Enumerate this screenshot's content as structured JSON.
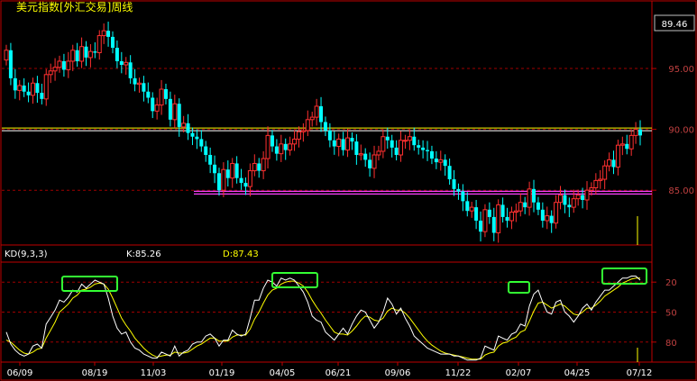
{
  "title": "美元指数[外汇交易]周线",
  "price_panel": {
    "last_value": "89.46",
    "y_ticks": [
      "95.00",
      "90.00",
      "85.00"
    ]
  },
  "kd_panel": {
    "label": "KD(9,3,3)",
    "k_text": "K:85.26",
    "d_text": "D:87.43",
    "y_ticks": [
      "80",
      "50",
      "20"
    ]
  },
  "colors": {
    "background": "#000000",
    "up_candle": "#ff3030",
    "down_candle": "#00ffff",
    "grid": "#a00000",
    "axis": "#c00000",
    "yellow_line": "#ffff00",
    "magenta_line": "#ff40ff",
    "highlight_box": "#33ff33",
    "k_line": "#ffffff",
    "d_line": "#ffff00"
  },
  "chart_data": [
    {
      "type": "candlestick",
      "ylim": [
        80.5,
        99.0
      ],
      "x_ticks": [
        "06/09",
        "08/19",
        "11/03",
        "01/19",
        "04/05",
        "06/21",
        "09/06",
        "11/22",
        "02/07",
        "04/25",
        "07/12"
      ],
      "horizontal_lines": [
        90.0,
        84.8
      ],
      "close": [
        96.5,
        94.2,
        93.2,
        93.6,
        93.1,
        92.8,
        93.8,
        93.0,
        92.5,
        94.5,
        94.8,
        95.1,
        95.6,
        94.9,
        95.6,
        96.5,
        95.6,
        96.8,
        95.9,
        96.4,
        96.3,
        97.7,
        98.1,
        97.6,
        96.7,
        95.6,
        95.3,
        95.5,
        94.2,
        93.7,
        93.8,
        93.1,
        92.6,
        91.5,
        92.0,
        93.3,
        92.5,
        90.8,
        92.1,
        90.2,
        90.5,
        89.7,
        89.4,
        89.2,
        88.6,
        87.9,
        87.1,
        86.4,
        85.0,
        86.7,
        86.0,
        87.2,
        86.0,
        85.6,
        85.3,
        86.6,
        87.2,
        86.6,
        87.6,
        89.5,
        88.6,
        88.0,
        88.8,
        88.3,
        88.8,
        89.2,
        89.8,
        89.9,
        90.8,
        91.0,
        91.9,
        90.6,
        89.9,
        89.1,
        88.6,
        89.2,
        88.3,
        89.3,
        89.0,
        87.9,
        88.0,
        87.5,
        86.8,
        87.9,
        88.2,
        89.4,
        89.1,
        88.5,
        87.9,
        89.1,
        89.1,
        89.4,
        88.7,
        88.5,
        88.3,
        88.2,
        87.6,
        87.3,
        87.5,
        87.0,
        85.9,
        85.1,
        84.9,
        84.1,
        83.3,
        83.6,
        82.5,
        81.6,
        83.4,
        82.8,
        81.5,
        83.8,
        82.8,
        82.5,
        83.2,
        83.3,
        84.0,
        83.6,
        85.1,
        84.0,
        83.4,
        82.5,
        82.9,
        82.3,
        84.0,
        84.6,
        83.8,
        83.6,
        84.3,
        84.6,
        84.2,
        85.0,
        85.2,
        85.8,
        85.9,
        87.0,
        87.5,
        86.9,
        88.7,
        88.8,
        88.4,
        89.5,
        90.0,
        89.5
      ]
    },
    {
      "type": "line",
      "ylim": [
        0,
        100
      ],
      "y_ticks": [
        20,
        50,
        80
      ],
      "series": [
        {
          "name": "K",
          "values": [
            30,
            18,
            12,
            8,
            6,
            8,
            16,
            18,
            14,
            38,
            45,
            52,
            62,
            60,
            65,
            72,
            70,
            78,
            74,
            78,
            82,
            80,
            78,
            64,
            46,
            34,
            28,
            30,
            20,
            14,
            12,
            8,
            6,
            4,
            4,
            10,
            8,
            6,
            16,
            6,
            10,
            12,
            18,
            20,
            20,
            26,
            28,
            24,
            16,
            22,
            22,
            32,
            28,
            26,
            28,
            44,
            62,
            62,
            74,
            82,
            80,
            76,
            84,
            82,
            84,
            82,
            76,
            70,
            60,
            46,
            42,
            40,
            30,
            26,
            22,
            28,
            34,
            28,
            38,
            46,
            52,
            50,
            42,
            34,
            40,
            50,
            64,
            58,
            48,
            54,
            44,
            36,
            26,
            22,
            18,
            14,
            12,
            10,
            8,
            8,
            8,
            6,
            6,
            4,
            2,
            2,
            2,
            4,
            16,
            14,
            12,
            26,
            24,
            22,
            28,
            30,
            38,
            36,
            56,
            68,
            72,
            60,
            50,
            48,
            60,
            62,
            50,
            46,
            40,
            46,
            54,
            58,
            52,
            60,
            66,
            72,
            72,
            76,
            80,
            84,
            84,
            86,
            86,
            82
          ]
        },
        {
          "name": "D",
          "values": [
            22,
            20,
            16,
            12,
            9,
            8,
            10,
            13,
            14,
            24,
            32,
            40,
            50,
            54,
            58,
            64,
            67,
            72,
            73,
            75,
            78,
            79,
            78,
            73,
            64,
            54,
            44,
            37,
            31,
            24,
            19,
            14,
            10,
            7,
            5,
            6,
            7,
            7,
            10,
            9,
            9,
            10,
            13,
            16,
            18,
            21,
            24,
            24,
            21,
            21,
            21,
            25,
            27,
            27,
            27,
            33,
            43,
            50,
            59,
            67,
            72,
            74,
            78,
            80,
            81,
            81,
            79,
            76,
            70,
            62,
            55,
            49,
            42,
            36,
            30,
            28,
            28,
            27,
            31,
            36,
            42,
            46,
            45,
            42,
            41,
            44,
            51,
            54,
            52,
            52,
            49,
            44,
            38,
            32,
            26,
            21,
            17,
            14,
            11,
            9,
            8,
            7,
            6,
            5,
            4,
            3,
            3,
            3,
            7,
            9,
            10,
            16,
            19,
            20,
            23,
            25,
            30,
            32,
            41,
            51,
            59,
            60,
            57,
            54,
            56,
            58,
            56,
            52,
            48,
            47,
            50,
            54,
            54,
            57,
            61,
            66,
            69,
            72,
            75,
            79,
            81,
            83,
            84,
            84
          ]
        }
      ]
    }
  ]
}
